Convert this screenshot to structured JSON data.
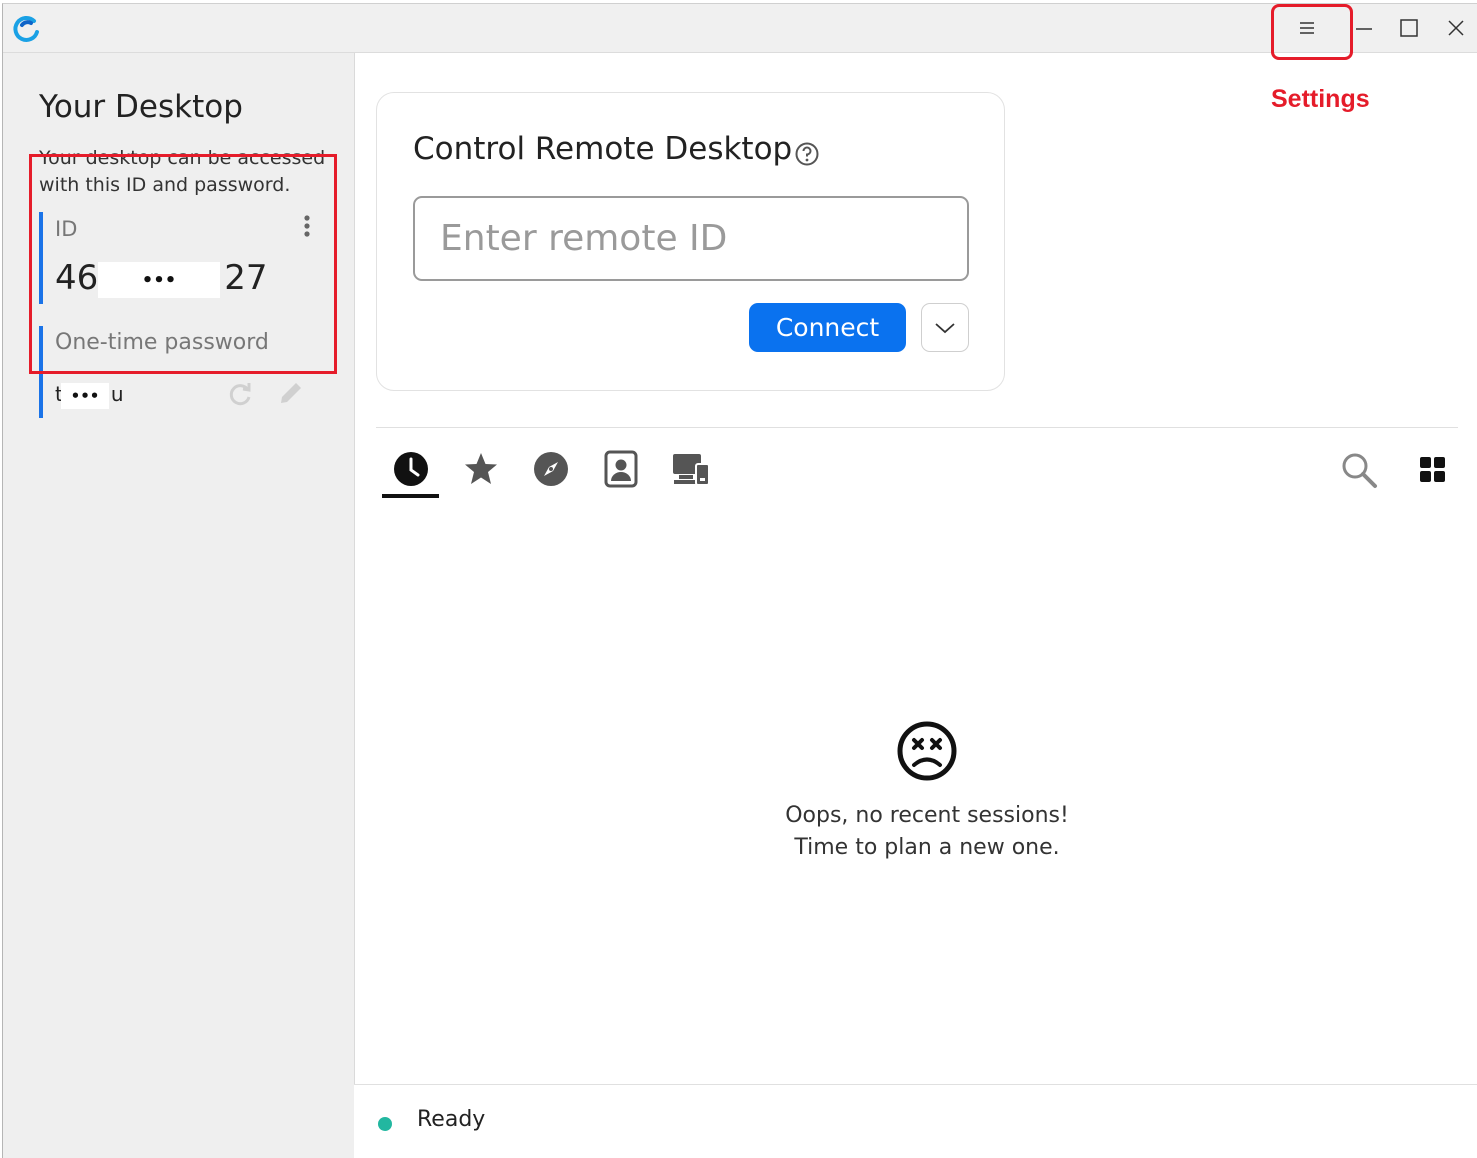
{
  "titlebar": {
    "logo_icon": "rustdesk-logo-icon",
    "menu_icon": "hamburger-menu-icon",
    "minimize_icon": "minimize-icon",
    "maximize_icon": "maximize-icon",
    "close_icon": "close-icon"
  },
  "annotation": {
    "settings_label": "Settings",
    "color": "#e51c2a"
  },
  "sidebar": {
    "title": "Your Desktop",
    "description": "Your desktop can be accessed with this ID and password.",
    "id_label": "ID",
    "id_value_start": "46",
    "id_value_end": "27",
    "id_masked": "•••",
    "password_label": "One-time password",
    "password_value_start": "t",
    "password_value_end": "u",
    "password_masked": "•••"
  },
  "connect": {
    "title": "Control Remote Desktop",
    "input_placeholder": "Enter remote ID",
    "input_value": "",
    "connect_label": "Connect",
    "accent_color": "#0a72ef"
  },
  "tabs": [
    {
      "name": "recent-sessions",
      "icon": "clock-icon",
      "active": true
    },
    {
      "name": "favorites",
      "icon": "star-icon",
      "active": false
    },
    {
      "name": "discovered",
      "icon": "compass-icon",
      "active": false
    },
    {
      "name": "address-book",
      "icon": "address-book-icon",
      "active": false
    },
    {
      "name": "accessible-devices",
      "icon": "devices-icon",
      "active": false
    }
  ],
  "empty_state": {
    "line1": "Oops, no recent sessions!",
    "line2": "Time to plan a new one."
  },
  "status": {
    "text": "Ready",
    "color": "#22b7a0"
  }
}
